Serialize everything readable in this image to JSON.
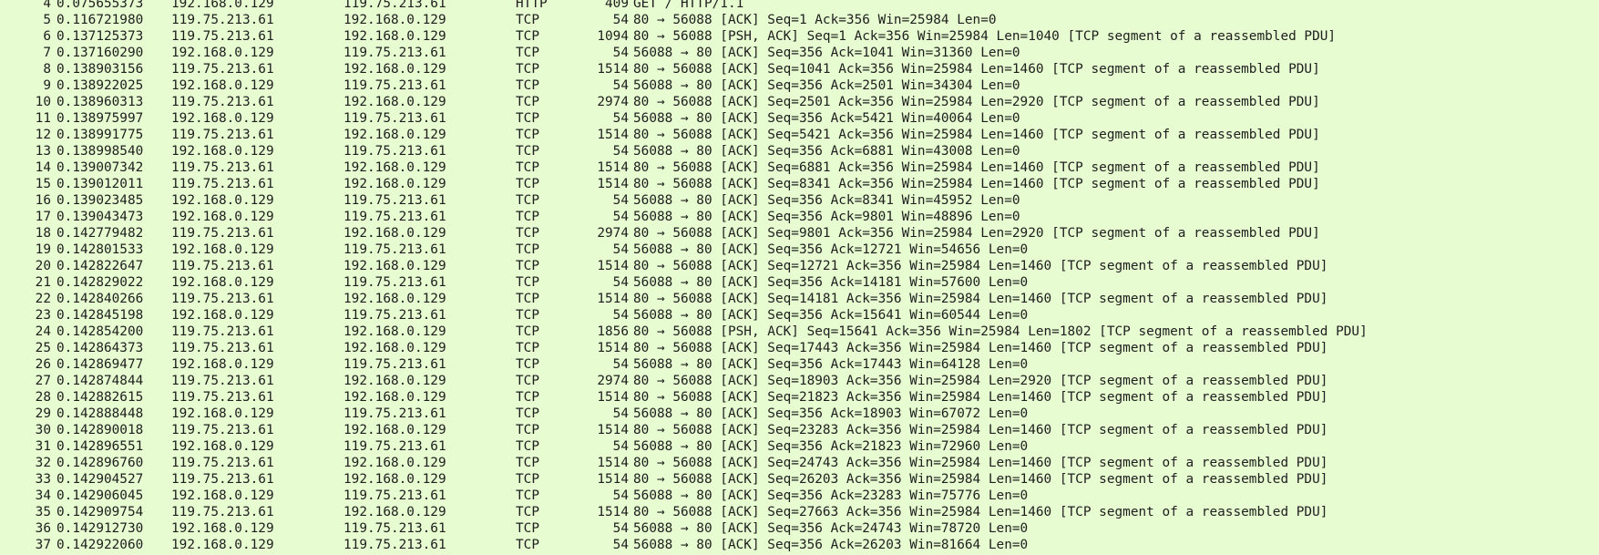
{
  "packet_list": {
    "rows": [
      {
        "no": "4",
        "time": "0.075655373",
        "src": "192.168.0.129",
        "dst": "119.75.213.61",
        "proto": "HTTP",
        "len": "409",
        "info": "GET / HTTP/1.1"
      },
      {
        "no": "5",
        "time": "0.116721980",
        "src": "119.75.213.61",
        "dst": "192.168.0.129",
        "proto": "TCP",
        "len": "54",
        "info": "80 → 56088 [ACK] Seq=1 Ack=356 Win=25984 Len=0"
      },
      {
        "no": "6",
        "time": "0.137125373",
        "src": "119.75.213.61",
        "dst": "192.168.0.129",
        "proto": "TCP",
        "len": "1094",
        "info": "80 → 56088 [PSH, ACK] Seq=1 Ack=356 Win=25984 Len=1040 [TCP segment of a reassembled PDU]"
      },
      {
        "no": "7",
        "time": "0.137160290",
        "src": "192.168.0.129",
        "dst": "119.75.213.61",
        "proto": "TCP",
        "len": "54",
        "info": "56088 → 80 [ACK] Seq=356 Ack=1041 Win=31360 Len=0"
      },
      {
        "no": "8",
        "time": "0.138903156",
        "src": "119.75.213.61",
        "dst": "192.168.0.129",
        "proto": "TCP",
        "len": "1514",
        "info": "80 → 56088 [ACK] Seq=1041 Ack=356 Win=25984 Len=1460 [TCP segment of a reassembled PDU]"
      },
      {
        "no": "9",
        "time": "0.138922025",
        "src": "192.168.0.129",
        "dst": "119.75.213.61",
        "proto": "TCP",
        "len": "54",
        "info": "56088 → 80 [ACK] Seq=356 Ack=2501 Win=34304 Len=0"
      },
      {
        "no": "10",
        "time": "0.138960313",
        "src": "119.75.213.61",
        "dst": "192.168.0.129",
        "proto": "TCP",
        "len": "2974",
        "info": "80 → 56088 [ACK] Seq=2501 Ack=356 Win=25984 Len=2920 [TCP segment of a reassembled PDU]"
      },
      {
        "no": "11",
        "time": "0.138975997",
        "src": "192.168.0.129",
        "dst": "119.75.213.61",
        "proto": "TCP",
        "len": "54",
        "info": "56088 → 80 [ACK] Seq=356 Ack=5421 Win=40064 Len=0"
      },
      {
        "no": "12",
        "time": "0.138991775",
        "src": "119.75.213.61",
        "dst": "192.168.0.129",
        "proto": "TCP",
        "len": "1514",
        "info": "80 → 56088 [ACK] Seq=5421 Ack=356 Win=25984 Len=1460 [TCP segment of a reassembled PDU]"
      },
      {
        "no": "13",
        "time": "0.138998540",
        "src": "192.168.0.129",
        "dst": "119.75.213.61",
        "proto": "TCP",
        "len": "54",
        "info": "56088 → 80 [ACK] Seq=356 Ack=6881 Win=43008 Len=0"
      },
      {
        "no": "14",
        "time": "0.139007342",
        "src": "119.75.213.61",
        "dst": "192.168.0.129",
        "proto": "TCP",
        "len": "1514",
        "info": "80 → 56088 [ACK] Seq=6881 Ack=356 Win=25984 Len=1460 [TCP segment of a reassembled PDU]"
      },
      {
        "no": "15",
        "time": "0.139012011",
        "src": "119.75.213.61",
        "dst": "192.168.0.129",
        "proto": "TCP",
        "len": "1514",
        "info": "80 → 56088 [ACK] Seq=8341 Ack=356 Win=25984 Len=1460 [TCP segment of a reassembled PDU]"
      },
      {
        "no": "16",
        "time": "0.139023485",
        "src": "192.168.0.129",
        "dst": "119.75.213.61",
        "proto": "TCP",
        "len": "54",
        "info": "56088 → 80 [ACK] Seq=356 Ack=8341 Win=45952 Len=0"
      },
      {
        "no": "17",
        "time": "0.139043473",
        "src": "192.168.0.129",
        "dst": "119.75.213.61",
        "proto": "TCP",
        "len": "54",
        "info": "56088 → 80 [ACK] Seq=356 Ack=9801 Win=48896 Len=0"
      },
      {
        "no": "18",
        "time": "0.142779482",
        "src": "119.75.213.61",
        "dst": "192.168.0.129",
        "proto": "TCP",
        "len": "2974",
        "info": "80 → 56088 [ACK] Seq=9801 Ack=356 Win=25984 Len=2920 [TCP segment of a reassembled PDU]"
      },
      {
        "no": "19",
        "time": "0.142801533",
        "src": "192.168.0.129",
        "dst": "119.75.213.61",
        "proto": "TCP",
        "len": "54",
        "info": "56088 → 80 [ACK] Seq=356 Ack=12721 Win=54656 Len=0"
      },
      {
        "no": "20",
        "time": "0.142822647",
        "src": "119.75.213.61",
        "dst": "192.168.0.129",
        "proto": "TCP",
        "len": "1514",
        "info": "80 → 56088 [ACK] Seq=12721 Ack=356 Win=25984 Len=1460 [TCP segment of a reassembled PDU]"
      },
      {
        "no": "21",
        "time": "0.142829022",
        "src": "192.168.0.129",
        "dst": "119.75.213.61",
        "proto": "TCP",
        "len": "54",
        "info": "56088 → 80 [ACK] Seq=356 Ack=14181 Win=57600 Len=0"
      },
      {
        "no": "22",
        "time": "0.142840266",
        "src": "119.75.213.61",
        "dst": "192.168.0.129",
        "proto": "TCP",
        "len": "1514",
        "info": "80 → 56088 [ACK] Seq=14181 Ack=356 Win=25984 Len=1460 [TCP segment of a reassembled PDU]"
      },
      {
        "no": "23",
        "time": "0.142845198",
        "src": "192.168.0.129",
        "dst": "119.75.213.61",
        "proto": "TCP",
        "len": "54",
        "info": "56088 → 80 [ACK] Seq=356 Ack=15641 Win=60544 Len=0"
      },
      {
        "no": "24",
        "time": "0.142854200",
        "src": "119.75.213.61",
        "dst": "192.168.0.129",
        "proto": "TCP",
        "len": "1856",
        "info": "80 → 56088 [PSH, ACK] Seq=15641 Ack=356 Win=25984 Len=1802 [TCP segment of a reassembled PDU]"
      },
      {
        "no": "25",
        "time": "0.142864373",
        "src": "119.75.213.61",
        "dst": "192.168.0.129",
        "proto": "TCP",
        "len": "1514",
        "info": "80 → 56088 [ACK] Seq=17443 Ack=356 Win=25984 Len=1460 [TCP segment of a reassembled PDU]"
      },
      {
        "no": "26",
        "time": "0.142869477",
        "src": "192.168.0.129",
        "dst": "119.75.213.61",
        "proto": "TCP",
        "len": "54",
        "info": "56088 → 80 [ACK] Seq=356 Ack=17443 Win=64128 Len=0"
      },
      {
        "no": "27",
        "time": "0.142874844",
        "src": "119.75.213.61",
        "dst": "192.168.0.129",
        "proto": "TCP",
        "len": "2974",
        "info": "80 → 56088 [ACK] Seq=18903 Ack=356 Win=25984 Len=2920 [TCP segment of a reassembled PDU]"
      },
      {
        "no": "28",
        "time": "0.142882615",
        "src": "119.75.213.61",
        "dst": "192.168.0.129",
        "proto": "TCP",
        "len": "1514",
        "info": "80 → 56088 [ACK] Seq=21823 Ack=356 Win=25984 Len=1460 [TCP segment of a reassembled PDU]"
      },
      {
        "no": "29",
        "time": "0.142888448",
        "src": "192.168.0.129",
        "dst": "119.75.213.61",
        "proto": "TCP",
        "len": "54",
        "info": "56088 → 80 [ACK] Seq=356 Ack=18903 Win=67072 Len=0"
      },
      {
        "no": "30",
        "time": "0.142890018",
        "src": "119.75.213.61",
        "dst": "192.168.0.129",
        "proto": "TCP",
        "len": "1514",
        "info": "80 → 56088 [ACK] Seq=23283 Ack=356 Win=25984 Len=1460 [TCP segment of a reassembled PDU]"
      },
      {
        "no": "31",
        "time": "0.142896551",
        "src": "192.168.0.129",
        "dst": "119.75.213.61",
        "proto": "TCP",
        "len": "54",
        "info": "56088 → 80 [ACK] Seq=356 Ack=21823 Win=72960 Len=0"
      },
      {
        "no": "32",
        "time": "0.142896760",
        "src": "119.75.213.61",
        "dst": "192.168.0.129",
        "proto": "TCP",
        "len": "1514",
        "info": "80 → 56088 [ACK] Seq=24743 Ack=356 Win=25984 Len=1460 [TCP segment of a reassembled PDU]"
      },
      {
        "no": "33",
        "time": "0.142904527",
        "src": "119.75.213.61",
        "dst": "192.168.0.129",
        "proto": "TCP",
        "len": "1514",
        "info": "80 → 56088 [ACK] Seq=26203 Ack=356 Win=25984 Len=1460 [TCP segment of a reassembled PDU]"
      },
      {
        "no": "34",
        "time": "0.142906045",
        "src": "192.168.0.129",
        "dst": "119.75.213.61",
        "proto": "TCP",
        "len": "54",
        "info": "56088 → 80 [ACK] Seq=356 Ack=23283 Win=75776 Len=0"
      },
      {
        "no": "35",
        "time": "0.142909754",
        "src": "119.75.213.61",
        "dst": "192.168.0.129",
        "proto": "TCP",
        "len": "1514",
        "info": "80 → 56088 [ACK] Seq=27663 Ack=356 Win=25984 Len=1460 [TCP segment of a reassembled PDU]"
      },
      {
        "no": "36",
        "time": "0.142912730",
        "src": "192.168.0.129",
        "dst": "119.75.213.61",
        "proto": "TCP",
        "len": "54",
        "info": "56088 → 80 [ACK] Seq=356 Ack=24743 Win=78720 Len=0"
      },
      {
        "no": "37",
        "time": "0.142922060",
        "src": "192.168.0.129",
        "dst": "119.75.213.61",
        "proto": "TCP",
        "len": "54",
        "info": "56088 → 80 [ACK] Seq=356 Ack=26203 Win=81664 Len=0"
      }
    ]
  }
}
